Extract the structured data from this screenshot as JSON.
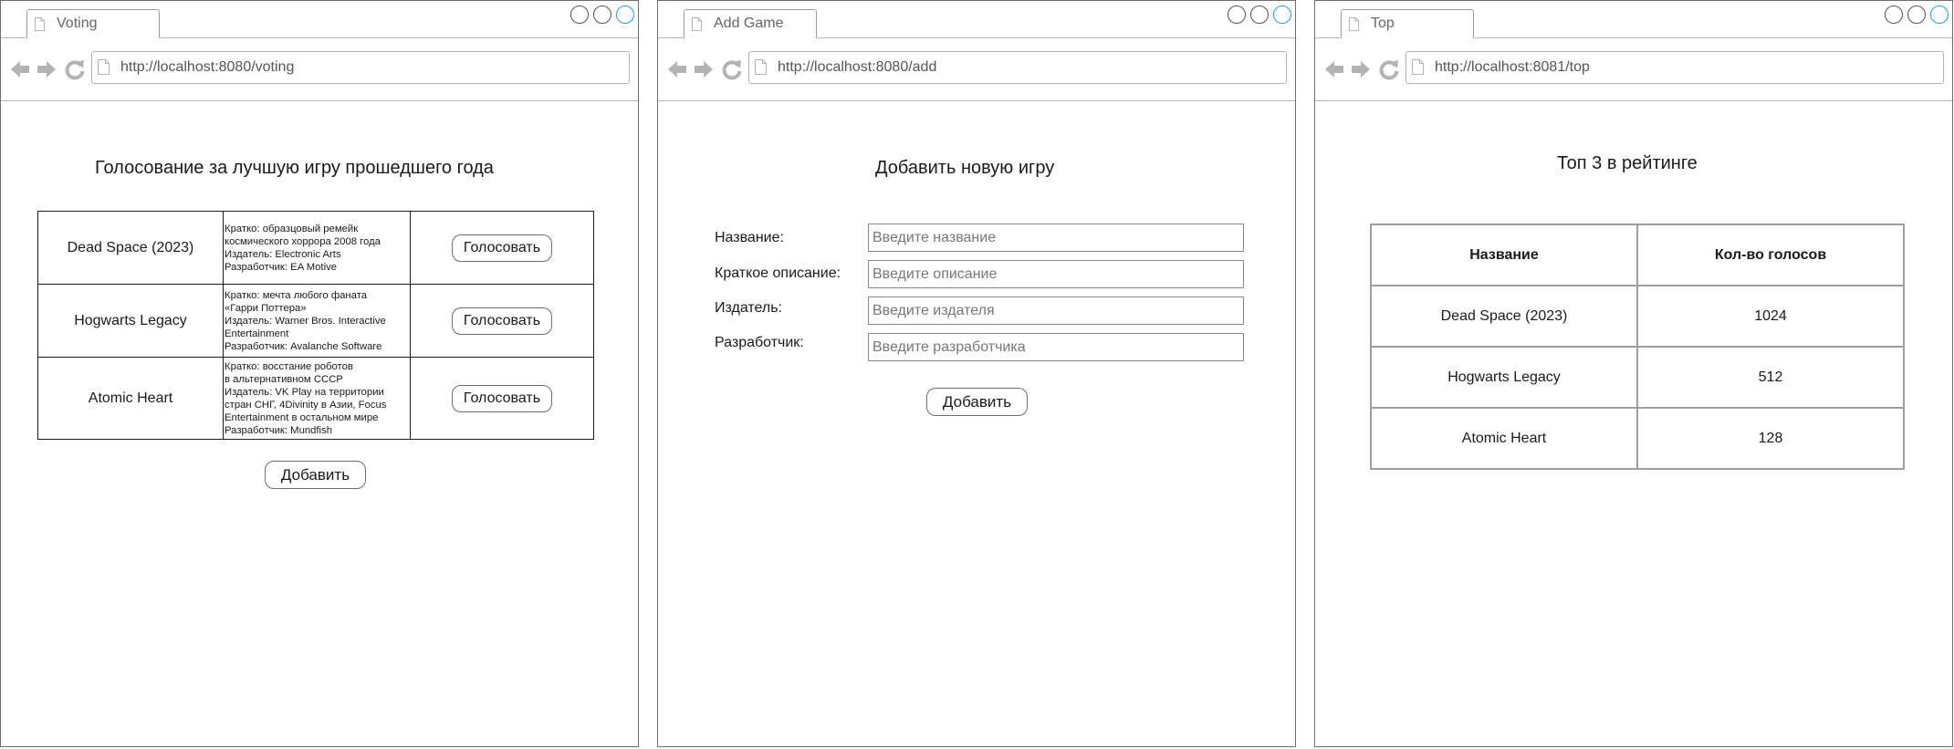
{
  "voting": {
    "tab_title": "Voting",
    "url": "http://localhost:8080/voting",
    "heading": "Голосование за лучшую игру прошедшего года",
    "games": [
      {
        "name": "Dead Space (2023)",
        "desc": [
          "Кратко: образцовый ремейк",
          "космического хоррора 2008 года",
          "Издатель: Electronic Arts",
          "Разработчик: EA Motive"
        ],
        "vote_label": "Голосовать"
      },
      {
        "name": "Hogwarts Legacy",
        "desc": [
          "Кратко: мечта любого фаната",
          "«Гарри Поттера»",
          "Издатель: Warner Bros. Interactive",
          "Entertainment",
          "Разработчик: Avalanche Software"
        ],
        "vote_label": "Голосовать"
      },
      {
        "name": "Atomic Heart",
        "desc": [
          "Кратко: восстание роботов",
          "в альтернативном СССР",
          "Издатель: VK Play на территории",
          "стран СНГ, 4Divinity в Азии, Focus",
          "Entertainment в остальном мире",
          "Разработчик: Mundfish"
        ],
        "vote_label": "Голосовать"
      }
    ],
    "add_label": "Добавить"
  },
  "add": {
    "tab_title": "Add Game",
    "url": "http://localhost:8080/add",
    "heading": "Добавить новую игру",
    "fields": [
      {
        "label": "Название:",
        "placeholder": "Введите название"
      },
      {
        "label": "Краткое описание:",
        "placeholder": "Введите описание"
      },
      {
        "label": "Издатель:",
        "placeholder": "Введите издателя"
      },
      {
        "label": "Разработчик:",
        "placeholder": "Введите разработчика"
      }
    ],
    "submit_label": "Добавить"
  },
  "top": {
    "tab_title": "Top",
    "url": "http://localhost:8081/top",
    "heading": "Топ 3 в рейтинге",
    "columns": [
      "Название",
      "Кол-во голосов"
    ],
    "rows": [
      {
        "name": "Dead Space (2023)",
        "votes": "1024"
      },
      {
        "name": "Hogwarts Legacy",
        "votes": "512"
      },
      {
        "name": "Atomic Heart",
        "votes": "128"
      }
    ]
  },
  "colors": {
    "frame": "#6e6e6e",
    "icon_gray": "#b3b3b3",
    "window_control_accent": "#1ba1e2"
  }
}
